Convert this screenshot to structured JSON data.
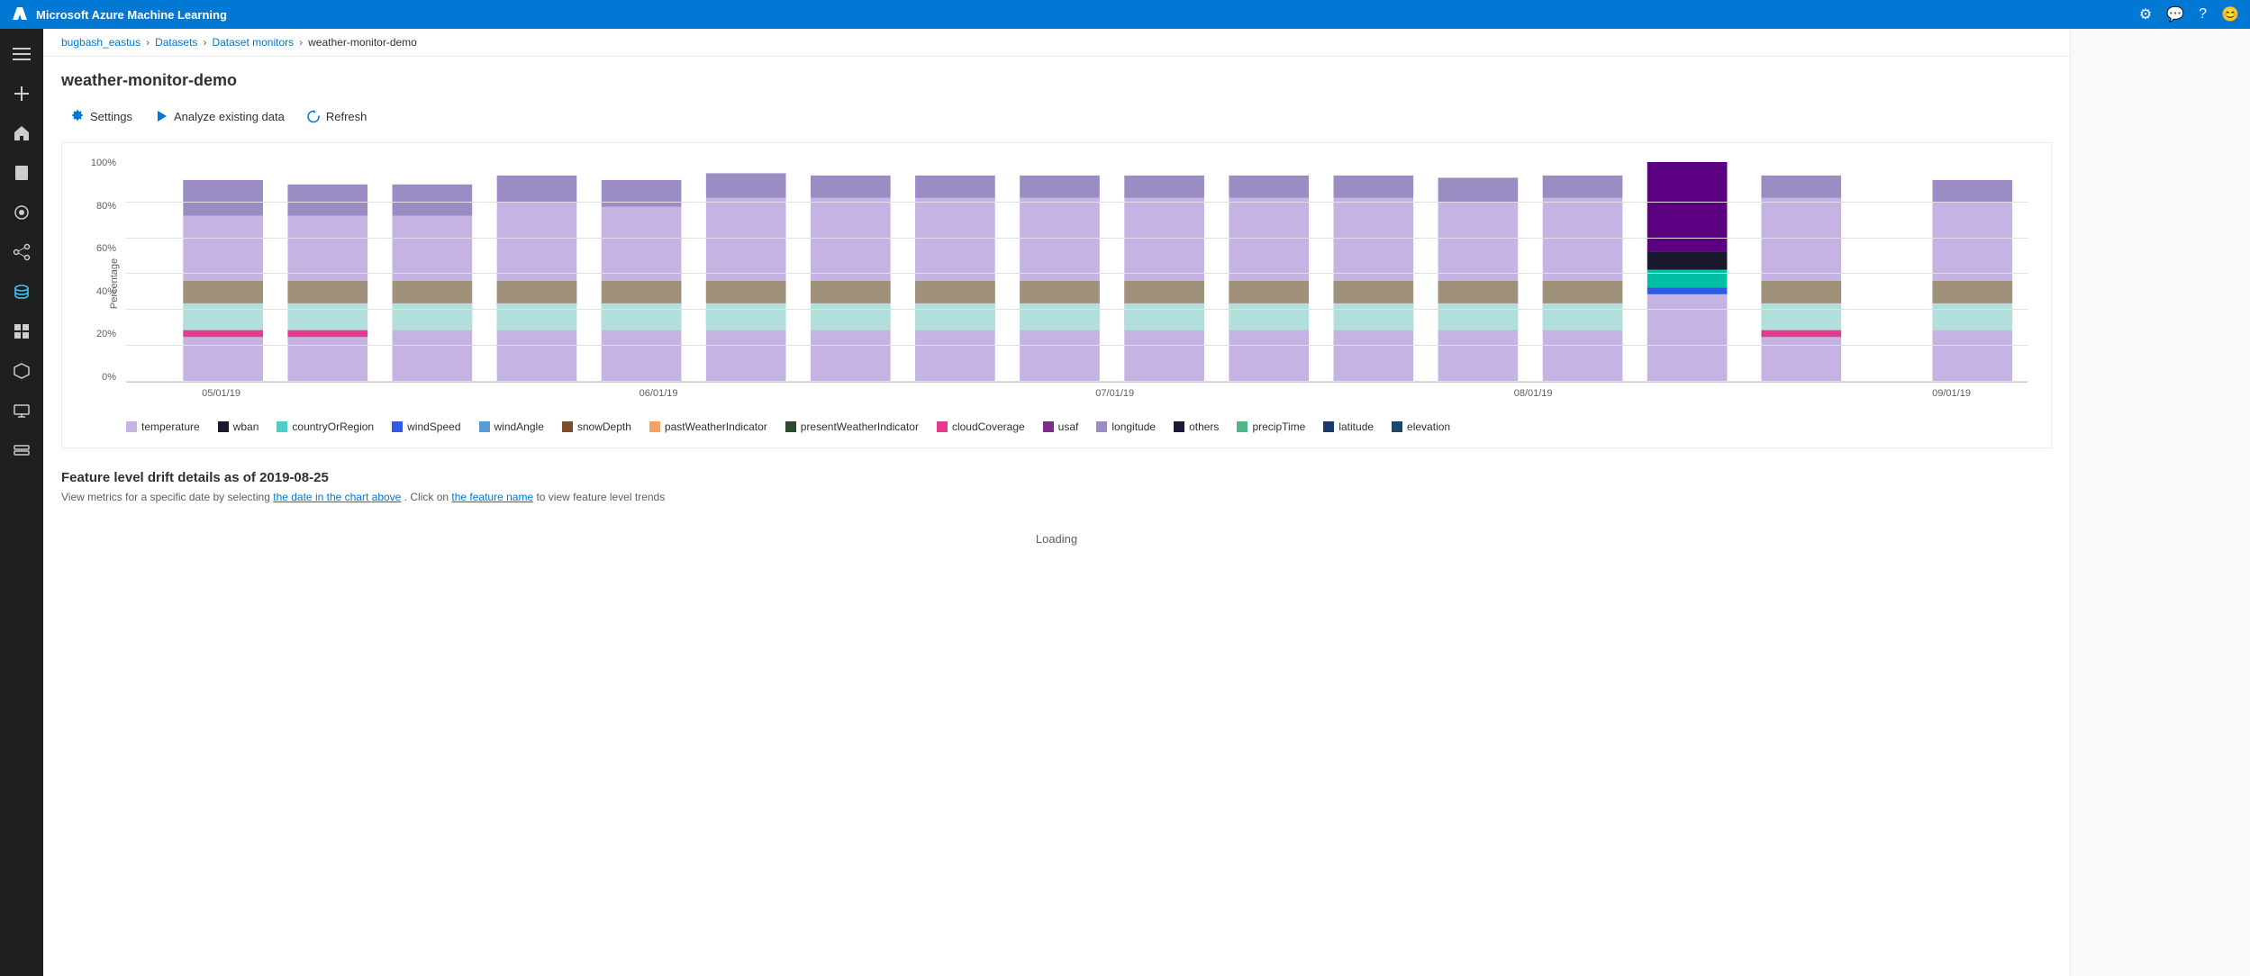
{
  "app": {
    "title": "Microsoft Azure Machine Learning"
  },
  "topbar": {
    "title": "Microsoft Azure Machine Learning",
    "icons": [
      "settings",
      "feedback",
      "help",
      "account"
    ]
  },
  "breadcrumb": {
    "items": [
      {
        "label": "bugbash_eastus",
        "link": true
      },
      {
        "label": "Datasets",
        "link": true
      },
      {
        "label": "Dataset monitors",
        "link": true
      },
      {
        "label": "weather-monitor-demo",
        "link": false
      }
    ]
  },
  "page": {
    "title": "weather-monitor-demo"
  },
  "toolbar": {
    "settings_label": "Settings",
    "analyze_label": "Analyze existing data",
    "refresh_label": "Refresh"
  },
  "chart": {
    "y_labels": [
      "100%",
      "80%",
      "60%",
      "40%",
      "20%",
      "0%"
    ],
    "y_axis_title": "Percentage",
    "x_labels": [
      {
        "label": "05/01/19",
        "pct": 0
      },
      {
        "label": "06/01/19",
        "pct": 27
      },
      {
        "label": "07/01/19",
        "pct": 52
      },
      {
        "label": "08/01/19",
        "pct": 74
      },
      {
        "label": "09/01/19",
        "pct": 96
      }
    ]
  },
  "legend": [
    {
      "label": "temperature",
      "color": "#c5b4e3"
    },
    {
      "label": "wban",
      "color": "#1a1a2e"
    },
    {
      "label": "countryOrRegion",
      "color": "#4ecdc4"
    },
    {
      "label": "windSpeed",
      "color": "#2d5be3"
    },
    {
      "label": "windAngle",
      "color": "#5b9bd5"
    },
    {
      "label": "snowDepth",
      "color": "#7b4f2e"
    },
    {
      "label": "pastWeatherIndicator",
      "color": "#f4a261"
    },
    {
      "label": "presentWeatherIndicator",
      "color": "#2d4a2d"
    },
    {
      "label": "cloudCoverage",
      "color": "#e63b8a"
    },
    {
      "label": "usaf",
      "color": "#7b2d8b"
    },
    {
      "label": "longitude",
      "color": "#9b8dc4"
    },
    {
      "label": "others",
      "color": "#1a1a3a"
    },
    {
      "label": "precipTime",
      "color": "#52b788"
    },
    {
      "label": "latitude",
      "color": "#1a3a6b"
    },
    {
      "label": "elevation",
      "color": "#1a4a6b"
    }
  ],
  "feature_section": {
    "title": "Feature level drift details as of 2019-08-25",
    "description_start": "View metrics for a specific date by selecting",
    "description_link1": "the date in the chart above",
    "description_middle": ". Click on",
    "description_link2": "the feature name",
    "description_end": "to view feature level trends",
    "loading": "Loading"
  },
  "sidebar": {
    "items": [
      {
        "name": "menu",
        "icon": "menu"
      },
      {
        "name": "home",
        "icon": "home"
      },
      {
        "name": "notebooks",
        "icon": "notebooks"
      },
      {
        "name": "experiments",
        "icon": "experiments"
      },
      {
        "name": "pipelines",
        "icon": "pipelines"
      },
      {
        "name": "datasets",
        "icon": "datasets",
        "active": true
      },
      {
        "name": "models",
        "icon": "models"
      },
      {
        "name": "endpoints",
        "icon": "endpoints"
      },
      {
        "name": "compute",
        "icon": "compute"
      },
      {
        "name": "datastores",
        "icon": "datastores"
      },
      {
        "name": "linked-services",
        "icon": "linked-services"
      }
    ]
  }
}
